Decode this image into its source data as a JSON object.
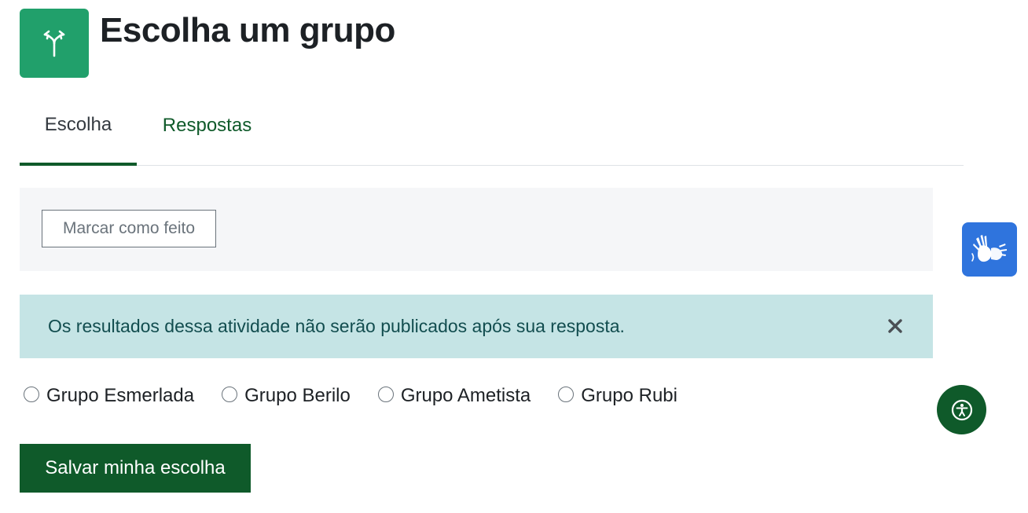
{
  "header": {
    "icon": "signpost-icon",
    "title": "Escolha um grupo"
  },
  "tabs": [
    {
      "label": "Escolha",
      "active": true
    },
    {
      "label": "Respostas",
      "active": false
    }
  ],
  "completion": {
    "mark_done_label": "Marcar como feito"
  },
  "alert": {
    "message": "Os resultados dessa atividade não serão publicados após sua resposta.",
    "close_icon": "close-icon"
  },
  "options": [
    {
      "label": "Grupo Esmerlada",
      "selected": false
    },
    {
      "label": "Grupo Berilo",
      "selected": false
    },
    {
      "label": "Grupo Ametista",
      "selected": false
    },
    {
      "label": "Grupo Rubi",
      "selected": false
    }
  ],
  "actions": {
    "save_label": "Salvar minha escolha"
  },
  "floating": {
    "sign_language_icon": "sign-language-hands-icon",
    "accessibility_icon": "accessibility-person-icon"
  },
  "colors": {
    "brand_green": "#0f5a2a",
    "activity_icon_bg": "#21a06b",
    "alert_bg": "#c5e4e5",
    "vlibras_blue": "#2f74dd"
  }
}
